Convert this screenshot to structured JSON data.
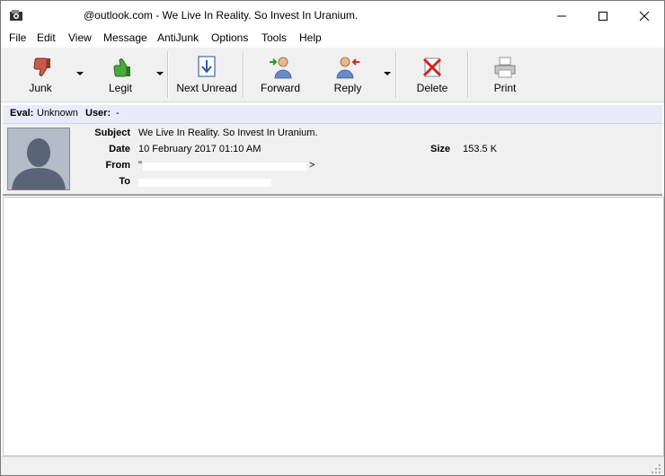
{
  "window": {
    "title_prefix": "",
    "title_suffix": "@outlook.com - We Live In Reality. So Invest In Uranium.",
    "controls": {
      "minimize": "—",
      "maximize": "☐",
      "close": "✕"
    }
  },
  "menu": [
    "File",
    "Edit",
    "View",
    "Message",
    "AntiJunk",
    "Options",
    "Tools",
    "Help"
  ],
  "toolbar": {
    "junk": "Junk",
    "legit": "Legit",
    "next_unread": "Next Unread",
    "forward": "Forward",
    "reply": "Reply",
    "delete": "Delete",
    "print": "Print"
  },
  "eval": {
    "eval_label": "Eval:",
    "eval_value": "Unknown",
    "user_label": "User:",
    "user_value": "-"
  },
  "message": {
    "subject_label": "Subject",
    "subject": "We Live In Reality. So Invest In Uranium.",
    "date_label": "Date",
    "date": "10 February 2017 01:10 AM",
    "size_label": "Size",
    "size": "153.5 K",
    "from_label": "From",
    "from": "\"",
    "from_end": ">",
    "to_label": "To",
    "to": ""
  },
  "colors": {
    "toolbar_bg": "#f0f0f0",
    "eval_bg": "#e8ecfa",
    "delete_red": "#d9201a",
    "thumb_green": "#3a9a2a",
    "thumb_red": "#b8392e"
  }
}
